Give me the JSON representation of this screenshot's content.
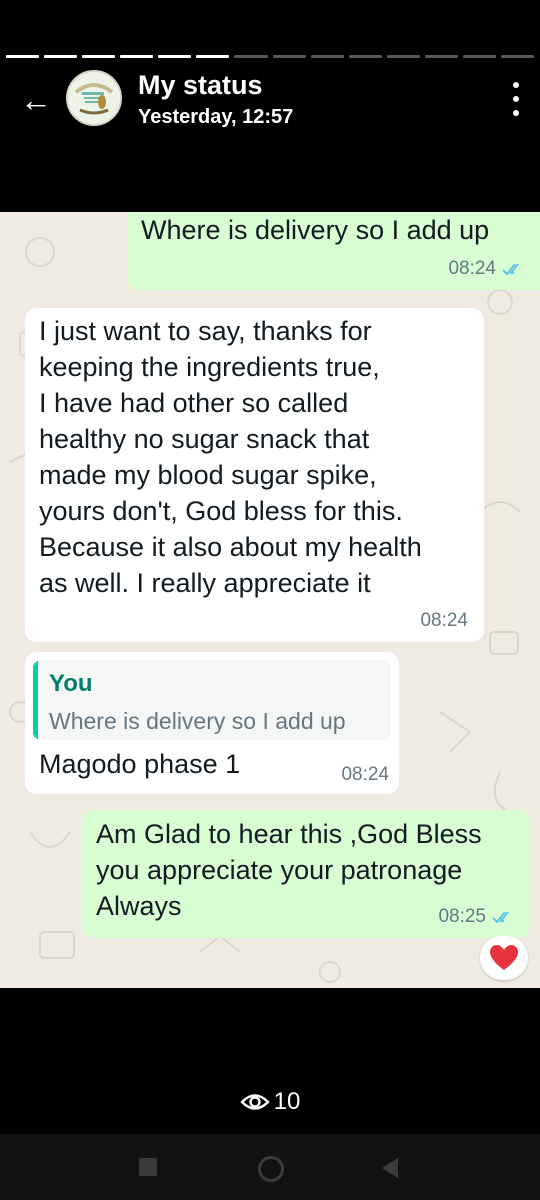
{
  "status_header": {
    "title": "My status",
    "timestamp": "Yesterday, 12:57",
    "progress_segments": 14,
    "progress_completed": 6
  },
  "messages": [
    {
      "direction": "outgoing",
      "text": "Where is delivery so I add up",
      "time": "08:24",
      "read": true
    },
    {
      "direction": "incoming",
      "lines": [
        "I just want to say, thanks for",
        "keeping the ingredients true,",
        "I have had other so called",
        "healthy no sugar snack that",
        "made my blood sugar spike,",
        "yours don't, God bless for this.",
        "Because it also about my health",
        "as well. I really appreciate it"
      ],
      "time": "08:24"
    },
    {
      "direction": "incoming",
      "quote": {
        "author": "You",
        "text": "Where is delivery so I add up"
      },
      "text": "Magodo phase 1",
      "time": "08:24"
    },
    {
      "direction": "outgoing",
      "lines": [
        "Am Glad to hear this ,God Bless",
        "you appreciate your patronage",
        "Always"
      ],
      "time": "08:25",
      "read": true,
      "reaction": "heart"
    }
  ],
  "views": {
    "count": "10",
    "icon": "eye-icon"
  },
  "colors": {
    "outgoing_bubble": "#d9fdd3",
    "incoming_bubble": "#ffffff",
    "chat_background": "#efeae2",
    "quote_accent": "#06cf9c",
    "read_ticks": "#53bdeb"
  }
}
